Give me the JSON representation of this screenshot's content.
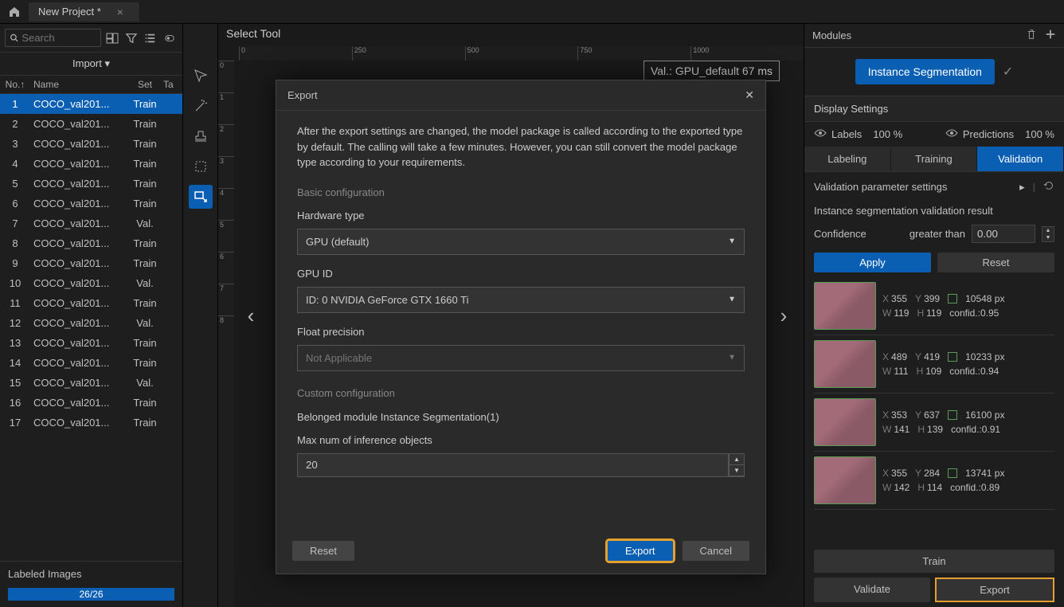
{
  "titlebar": {
    "project": "New Project *"
  },
  "left": {
    "search_placeholder": "Search",
    "import_label": "Import ▾",
    "table": {
      "head_no": "No.↑",
      "head_name": "Name",
      "head_set": "Set",
      "head_ta": "Ta",
      "rows": [
        {
          "no": "1",
          "name": "COCO_val201...",
          "set": "Train"
        },
        {
          "no": "2",
          "name": "COCO_val201...",
          "set": "Train"
        },
        {
          "no": "3",
          "name": "COCO_val201...",
          "set": "Train"
        },
        {
          "no": "4",
          "name": "COCO_val201...",
          "set": "Train"
        },
        {
          "no": "5",
          "name": "COCO_val201...",
          "set": "Train"
        },
        {
          "no": "6",
          "name": "COCO_val201...",
          "set": "Train"
        },
        {
          "no": "7",
          "name": "COCO_val201...",
          "set": "Val."
        },
        {
          "no": "8",
          "name": "COCO_val201...",
          "set": "Train"
        },
        {
          "no": "9",
          "name": "COCO_val201...",
          "set": "Train"
        },
        {
          "no": "10",
          "name": "COCO_val201...",
          "set": "Val."
        },
        {
          "no": "11",
          "name": "COCO_val201...",
          "set": "Train"
        },
        {
          "no": "12",
          "name": "COCO_val201...",
          "set": "Val."
        },
        {
          "no": "13",
          "name": "COCO_val201...",
          "set": "Train"
        },
        {
          "no": "14",
          "name": "COCO_val201...",
          "set": "Train"
        },
        {
          "no": "15",
          "name": "COCO_val201...",
          "set": "Val."
        },
        {
          "no": "16",
          "name": "COCO_val201...",
          "set": "Train"
        },
        {
          "no": "17",
          "name": "COCO_val201...",
          "set": "Train"
        }
      ]
    },
    "labeled_title": "Labeled Images",
    "progress_label": "26/26"
  },
  "center": {
    "title": "Select Tool",
    "status": "Val.: GPU_default 67 ms"
  },
  "right": {
    "modules_title": "Modules",
    "pill_label": "Instance Segmentation",
    "display_title": "Display Settings",
    "labels_label": "Labels",
    "labels_pct": "100 %",
    "predictions_label": "Predictions",
    "predictions_pct": "100 %",
    "tab_labeling": "Labeling",
    "tab_training": "Training",
    "tab_validation": "Validation",
    "param_label": "Validation parameter settings",
    "result_title": "Instance segmentation validation result",
    "confidence_label": "Confidence",
    "greater_label": "greater than",
    "confidence_value": "0.00",
    "apply_label": "Apply",
    "reset_label": "Reset",
    "results": [
      {
        "x": "355",
        "y": "399",
        "px": "10548 px",
        "w": "119",
        "h": "119",
        "conf": "confid.:0.95"
      },
      {
        "x": "489",
        "y": "419",
        "px": "10233 px",
        "w": "111",
        "h": "109",
        "conf": "confid.:0.94"
      },
      {
        "x": "353",
        "y": "637",
        "px": "16100 px",
        "w": "141",
        "h": "139",
        "conf": "confid.:0.91"
      },
      {
        "x": "355",
        "y": "284",
        "px": "13741 px",
        "w": "142",
        "h": "114",
        "conf": "confid.:0.89"
      }
    ],
    "train_label": "Train",
    "validate_label": "Validate",
    "export_label": "Export"
  },
  "modal": {
    "title": "Export",
    "intro": "After the export settings are changed, the model package is called according to the exported type by default. The calling will take a few minutes. However, you can still convert the model package type according to your requirements.",
    "basic_header": "Basic configuration",
    "hw_label": "Hardware type",
    "hw_value": "GPU (default)",
    "gpu_label": "GPU ID",
    "gpu_value": "ID: 0  NVIDIA GeForce GTX 1660 Ti",
    "precision_label": "Float precision",
    "precision_value": "Not Applicable",
    "custom_header": "Custom configuration",
    "belonged_label": "Belonged module Instance Segmentation(1)",
    "max_label": "Max num of inference objects",
    "max_value": "20",
    "btn_reset": "Reset",
    "btn_export": "Export",
    "btn_cancel": "Cancel"
  }
}
